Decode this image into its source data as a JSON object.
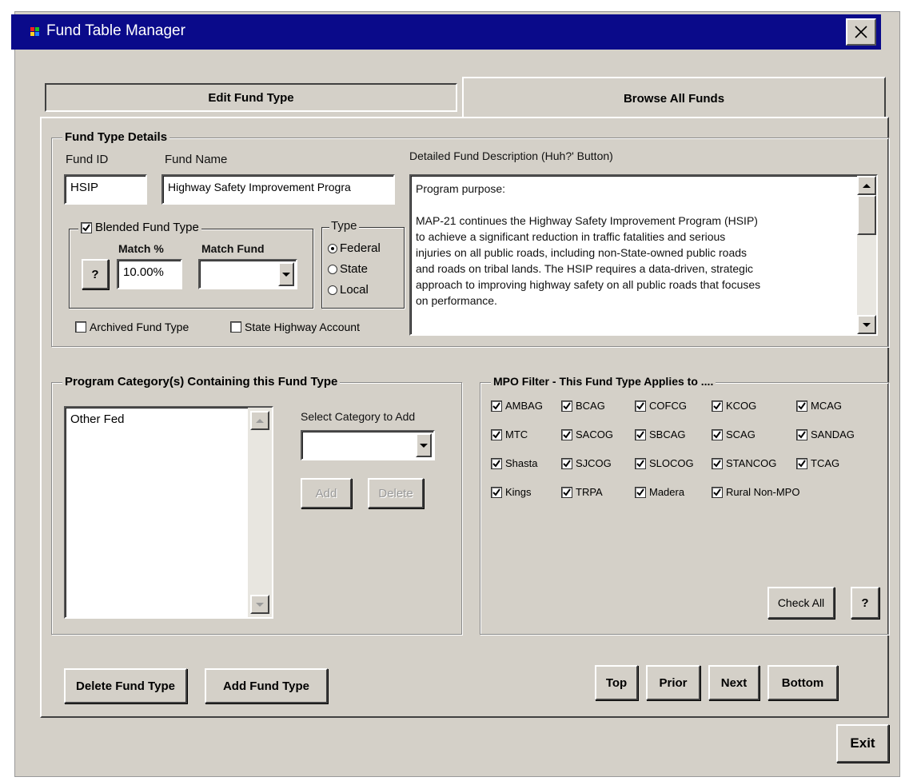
{
  "window": {
    "title": "Fund Table Manager"
  },
  "tabs": {
    "edit": "Edit Fund Type",
    "browse": "Browse All Funds"
  },
  "details": {
    "legend": "Fund Type Details",
    "fund_id_label": "Fund ID",
    "fund_id": "HSIP",
    "fund_name_label": "Fund Name",
    "fund_name": "Highway Safety Improvement Progra",
    "desc_label": "Detailed Fund Description (Huh?' Button)",
    "desc_lines": [
      "Program purpose:",
      "",
      "MAP-21 continues the Highway Safety Improvement Program (HSIP)",
      "to achieve a significant reduction in traffic fatalities and serious",
      "injuries on all public roads, including non-State-owned public roads",
      "and roads on tribal lands. The HSIP requires a data-driven, strategic",
      "approach to improving highway safety on all public roads that focuses",
      "on performance."
    ],
    "blended_label": "Blended Fund Type",
    "blended_checked": true,
    "match_pct_label": "Match %",
    "match_pct": "10.00%",
    "match_fund_label": "Match Fund",
    "match_fund": "",
    "help_label": "?",
    "type_label": "Type",
    "type_options": [
      "Federal",
      "State",
      "Local"
    ],
    "type_selected": "Federal",
    "archived_label": "Archived Fund Type",
    "state_hwy_label": "State Highway Account"
  },
  "program": {
    "legend": "Program Category(s) Containing this Fund Type",
    "items": [
      "Other Fed"
    ],
    "select_label": "Select Category to Add",
    "add_label": "Add",
    "delete_label": "Delete"
  },
  "mpo": {
    "legend": "MPO Filter - This Fund Type Applies to ....",
    "items": [
      "AMBAG",
      "BCAG",
      "COFCG",
      "KCOG",
      "MCAG",
      "MTC",
      "SACOG",
      "SBCAG",
      "SCAG",
      "SANDAG",
      "Shasta",
      "SJCOG",
      "SLOCOG",
      "STANCOG",
      "TCAG",
      "Kings",
      "TRPA",
      "Madera",
      "Rural Non-MPO"
    ],
    "check_all_label": "Check All",
    "help_label": "?"
  },
  "footer": {
    "delete_fund_type": "Delete Fund Type",
    "add_fund_type": "Add Fund Type",
    "top": "Top",
    "prior": "Prior",
    "next": "Next",
    "bottom": "Bottom",
    "exit": "Exit"
  }
}
